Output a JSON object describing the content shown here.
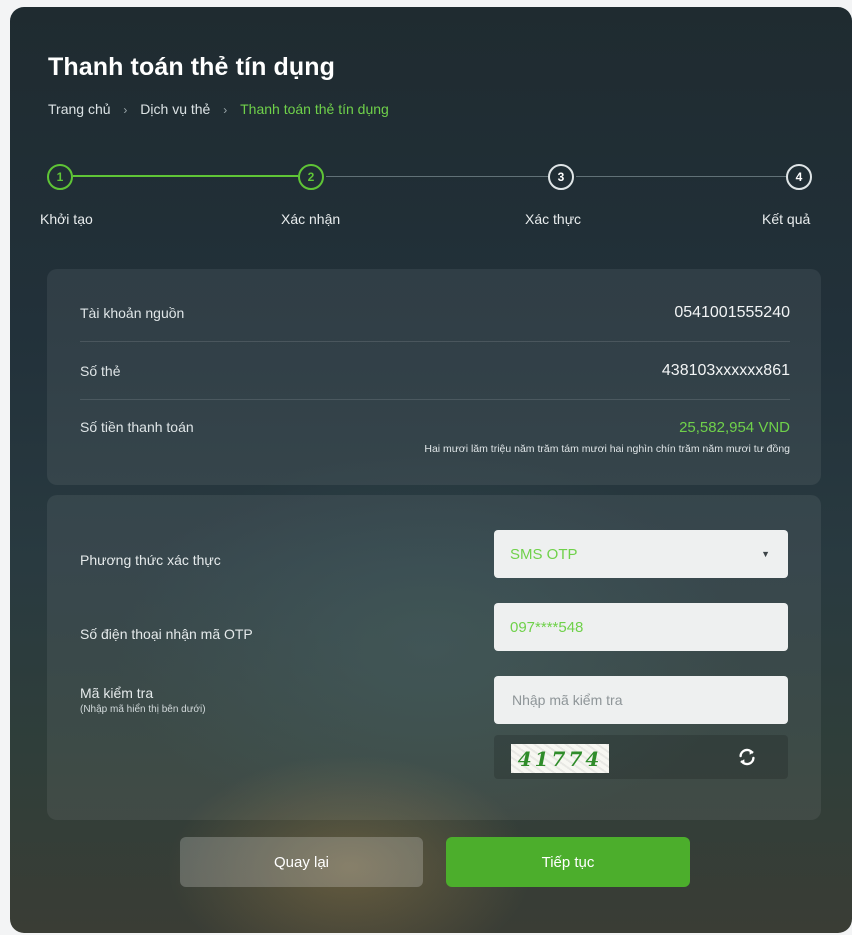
{
  "page": {
    "title": "Thanh toán thẻ tín dụng",
    "breadcrumb": [
      "Trang chủ",
      "Dịch vụ thẻ",
      "Thanh toán thẻ tín dụng"
    ]
  },
  "steps": [
    {
      "number": "1",
      "label": "Khởi tạo",
      "status": "done"
    },
    {
      "number": "2",
      "label": "Xác nhận",
      "status": "done"
    },
    {
      "number": "3",
      "label": "Xác thực",
      "status": "pending"
    },
    {
      "number": "4",
      "label": "Kết quả",
      "status": "pending"
    }
  ],
  "summary": {
    "source_account_label": "Tài khoản nguồn",
    "source_account_value": "0541001555240",
    "card_number_label": "Số thẻ",
    "card_number_value": "438103xxxxxx861",
    "amount_label": "Số tiền thanh toán",
    "amount_value": "25,582,954 VND",
    "amount_in_words": "Hai mươi lăm triệu năm trăm tám mươi hai nghìn chín trăm năm mươi tư đồng"
  },
  "auth": {
    "method_label": "Phương thức xác thực",
    "method_value": "SMS OTP",
    "phone_label": "Số điện thoại nhận mã OTP",
    "phone_value": "097****548",
    "captcha_label": "Mã kiểm tra",
    "captcha_hint": "(Nhập mã hiển thị bên dưới)",
    "captcha_placeholder": "Nhập mã kiểm tra",
    "captcha_code": "41774",
    "refresh_icon": "refresh-icon"
  },
  "buttons": {
    "back": "Quay lại",
    "next": "Tiếp tục"
  },
  "colors": {
    "accent": "#5fc536",
    "primary_button": "#4cae2c"
  }
}
